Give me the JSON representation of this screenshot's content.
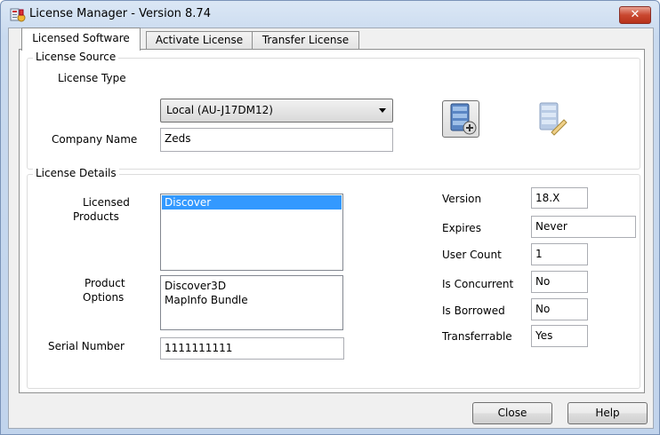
{
  "window": {
    "title": "License Manager - Version 8.74",
    "close_glyph": "✕"
  },
  "tabs": [
    {
      "label": "Licensed Software",
      "active": true
    },
    {
      "label": "Activate License",
      "active": false
    },
    {
      "label": "Transfer License",
      "active": false
    }
  ],
  "license_source": {
    "legend": "License Source",
    "license_type_label": "License Type",
    "license_type_value": "Local (AU-J17DM12)",
    "company_name_label": "Company Name",
    "company_name_value": "Zeds",
    "icons": [
      "license-server-connect-icon",
      "license-server-edit-icon"
    ]
  },
  "license_details": {
    "legend": "License Details",
    "licensed_products_label_1": "Licensed",
    "licensed_products_label_2": "Products",
    "licensed_products": [
      "Discover"
    ],
    "product_options_label_1": "Product",
    "product_options_label_2": "Options",
    "product_options": [
      "Discover3D",
      "MapInfo Bundle"
    ],
    "serial_number_label": "Serial Number",
    "serial_number_value": "1111111111",
    "version_label": "Version",
    "version_value": "18.X",
    "expires_label": "Expires",
    "expires_value": "Never",
    "user_count_label": "User Count",
    "user_count_value": "1",
    "is_concurrent_label": "Is Concurrent",
    "is_concurrent_value": "No",
    "is_borrowed_label": "Is Borrowed",
    "is_borrowed_value": "No",
    "transferrable_label": "Transferrable",
    "transferrable_value": "Yes"
  },
  "buttons": {
    "close": "Close",
    "help": "Help"
  },
  "colors": {
    "selection": "#3399ff",
    "close_button": "#c9472f"
  }
}
